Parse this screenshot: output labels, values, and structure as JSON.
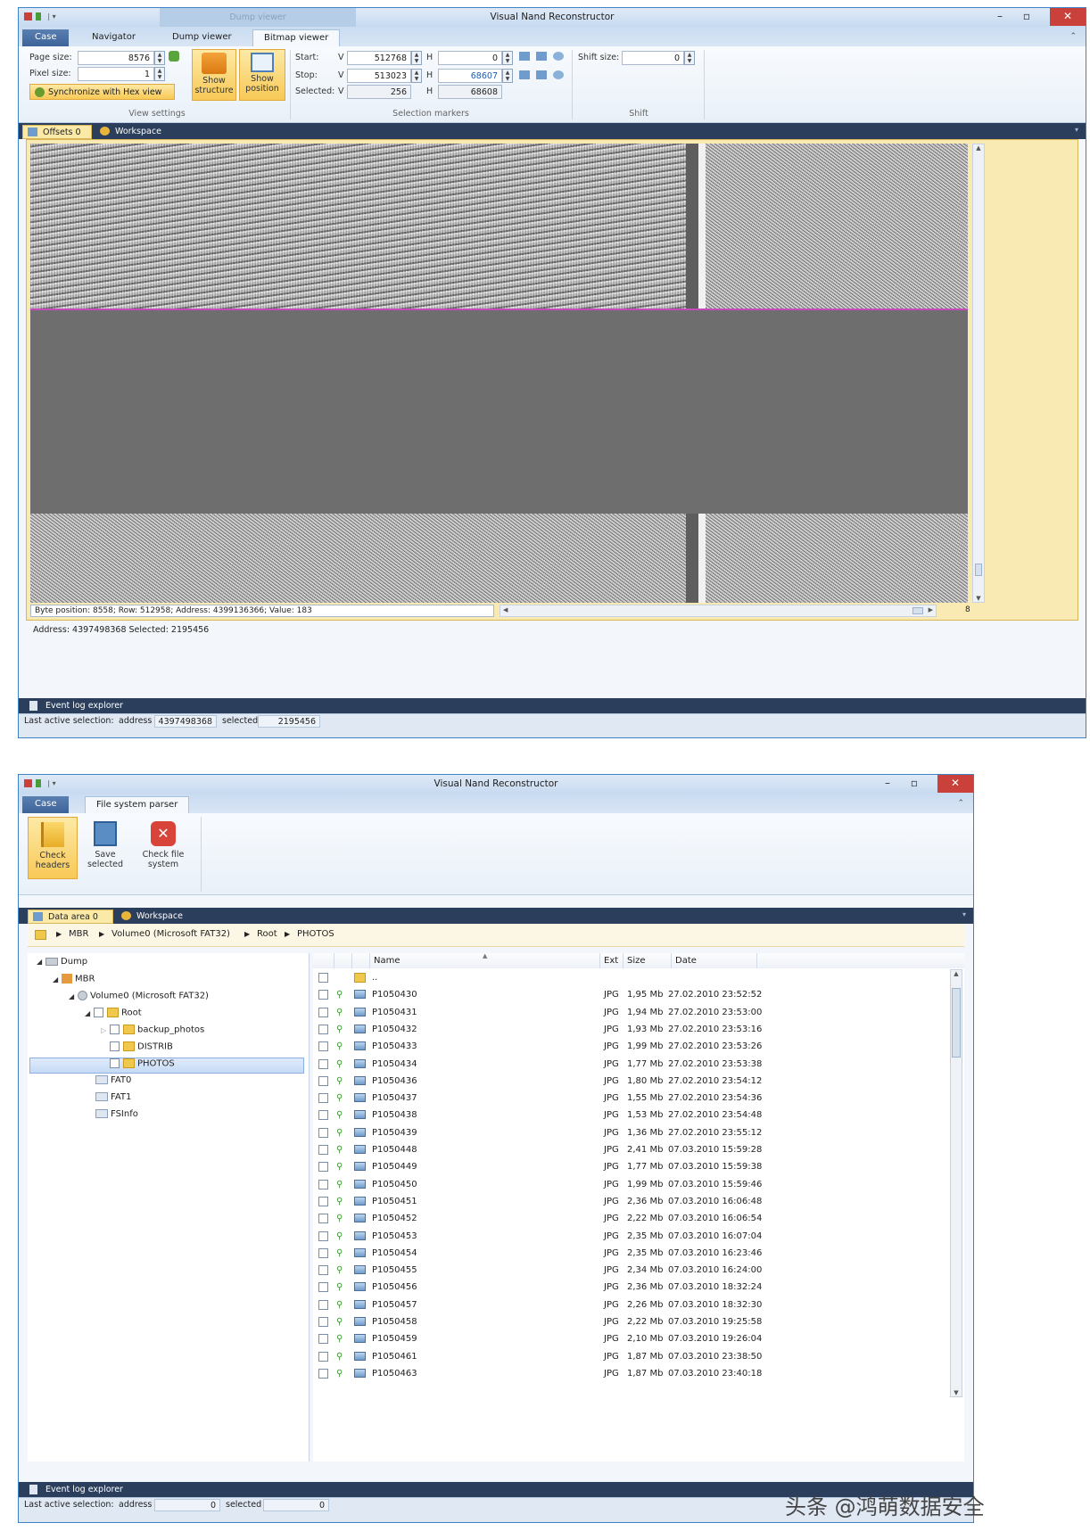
{
  "app_title": "Visual Nand Reconstructor",
  "win1": {
    "context_tab": "Dump viewer",
    "tabs": [
      "Case",
      "Navigator",
      "Dump viewer",
      "Bitmap viewer"
    ],
    "view_settings": {
      "label": "View settings",
      "page_size_label": "Page size:",
      "page_size_value": "8576",
      "pixel_size_label": "Pixel size:",
      "pixel_size_value": "1",
      "sync_button": "Synchronize with Hex view",
      "show_structure": "Show structure",
      "show_position": "Show position"
    },
    "selection_markers": {
      "label": "Selection markers",
      "start_label": "Start:",
      "stop_label": "Stop:",
      "selected_label": "Selected:",
      "v_label": "V",
      "h_label": "H",
      "start_v": "512768",
      "start_h": "0",
      "stop_v": "513023",
      "stop_h": "68607",
      "selected_v": "256",
      "selected_h": "68608"
    },
    "shift": {
      "label": "Shift",
      "shift_size_label": "Shift size:",
      "shift_size_value": "0"
    },
    "doc_tabs": [
      "Offsets 0",
      "Workspace"
    ],
    "info_line": "Byte position: 8558; Row: 512958; Address: 4399136366; Value: 183",
    "address_line": "Address:  4397498368   Selected:  2195456",
    "scroll_page_value": "8",
    "event_log": "Event log explorer",
    "status": {
      "label": "Last active selection:",
      "address_label": "address",
      "address_value": "4397498368",
      "selected_label": "selected",
      "selected_value": "2195456"
    }
  },
  "win2": {
    "tabs": [
      "Case",
      "File system parser"
    ],
    "buttons": {
      "check_headers": "Check headers",
      "save_selected": "Save selected",
      "check_fs": "Check file system"
    },
    "doc_tabs": [
      "Data area 0",
      "Workspace"
    ],
    "breadcrumb": [
      "MBR",
      "Volume0 (Microsoft FAT32)",
      "Root",
      "PHOTOS"
    ],
    "tree": {
      "dump": "Dump",
      "mbr": "MBR",
      "volume": "Volume0 (Microsoft FAT32)",
      "root": "Root",
      "backup": "backup_photos",
      "distrib": "DISTRIB",
      "photos": "PHOTOS",
      "fat0": "FAT0",
      "fat1": "FAT1",
      "fsinfo": "FSInfo"
    },
    "columns": {
      "name": "Name",
      "ext": "Ext",
      "size": "Size",
      "date": "Date"
    },
    "parent_entry": "..",
    "files": [
      {
        "name": "P1050430",
        "ext": "JPG",
        "size": "1,95 Mb",
        "date": "27.02.2010 23:52:52"
      },
      {
        "name": "P1050431",
        "ext": "JPG",
        "size": "1,94 Mb",
        "date": "27.02.2010 23:53:00"
      },
      {
        "name": "P1050432",
        "ext": "JPG",
        "size": "1,93 Mb",
        "date": "27.02.2010 23:53:16"
      },
      {
        "name": "P1050433",
        "ext": "JPG",
        "size": "1,99 Mb",
        "date": "27.02.2010 23:53:26"
      },
      {
        "name": "P1050434",
        "ext": "JPG",
        "size": "1,77 Mb",
        "date": "27.02.2010 23:53:38"
      },
      {
        "name": "P1050436",
        "ext": "JPG",
        "size": "1,80 Mb",
        "date": "27.02.2010 23:54:12"
      },
      {
        "name": "P1050437",
        "ext": "JPG",
        "size": "1,55 Mb",
        "date": "27.02.2010 23:54:36"
      },
      {
        "name": "P1050438",
        "ext": "JPG",
        "size": "1,53 Mb",
        "date": "27.02.2010 23:54:48"
      },
      {
        "name": "P1050439",
        "ext": "JPG",
        "size": "1,36 Mb",
        "date": "27.02.2010 23:55:12"
      },
      {
        "name": "P1050448",
        "ext": "JPG",
        "size": "2,41 Mb",
        "date": "07.03.2010 15:59:28"
      },
      {
        "name": "P1050449",
        "ext": "JPG",
        "size": "1,77 Mb",
        "date": "07.03.2010 15:59:38"
      },
      {
        "name": "P1050450",
        "ext": "JPG",
        "size": "1,99 Mb",
        "date": "07.03.2010 15:59:46"
      },
      {
        "name": "P1050451",
        "ext": "JPG",
        "size": "2,36 Mb",
        "date": "07.03.2010 16:06:48"
      },
      {
        "name": "P1050452",
        "ext": "JPG",
        "size": "2,22 Mb",
        "date": "07.03.2010 16:06:54"
      },
      {
        "name": "P1050453",
        "ext": "JPG",
        "size": "2,35 Mb",
        "date": "07.03.2010 16:07:04"
      },
      {
        "name": "P1050454",
        "ext": "JPG",
        "size": "2,35 Mb",
        "date": "07.03.2010 16:23:46"
      },
      {
        "name": "P1050455",
        "ext": "JPG",
        "size": "2,34 Mb",
        "date": "07.03.2010 16:24:00"
      },
      {
        "name": "P1050456",
        "ext": "JPG",
        "size": "2,36 Mb",
        "date": "07.03.2010 18:32:24"
      },
      {
        "name": "P1050457",
        "ext": "JPG",
        "size": "2,26 Mb",
        "date": "07.03.2010 18:32:30"
      },
      {
        "name": "P1050458",
        "ext": "JPG",
        "size": "2,22 Mb",
        "date": "07.03.2010 19:25:58"
      },
      {
        "name": "P1050459",
        "ext": "JPG",
        "size": "2,10 Mb",
        "date": "07.03.2010 19:26:04"
      },
      {
        "name": "P1050461",
        "ext": "JPG",
        "size": "1,87 Mb",
        "date": "07.03.2010 23:38:50"
      },
      {
        "name": "P1050463",
        "ext": "JPG",
        "size": "1,87 Mb",
        "date": "07.03.2010 23:40:18"
      }
    ],
    "event_log": "Event log explorer",
    "status": {
      "label": "Last active selection:",
      "address_label": "address",
      "address_value": "0",
      "selected_label": "selected",
      "selected_value": "0"
    }
  },
  "watermark": "头条 @鸿萌数据安全",
  "colors": {
    "accent": "#3f83c7",
    "dark_bar": "#2b3f5c",
    "close": "#c9413a",
    "highlight": "#f8c956"
  }
}
